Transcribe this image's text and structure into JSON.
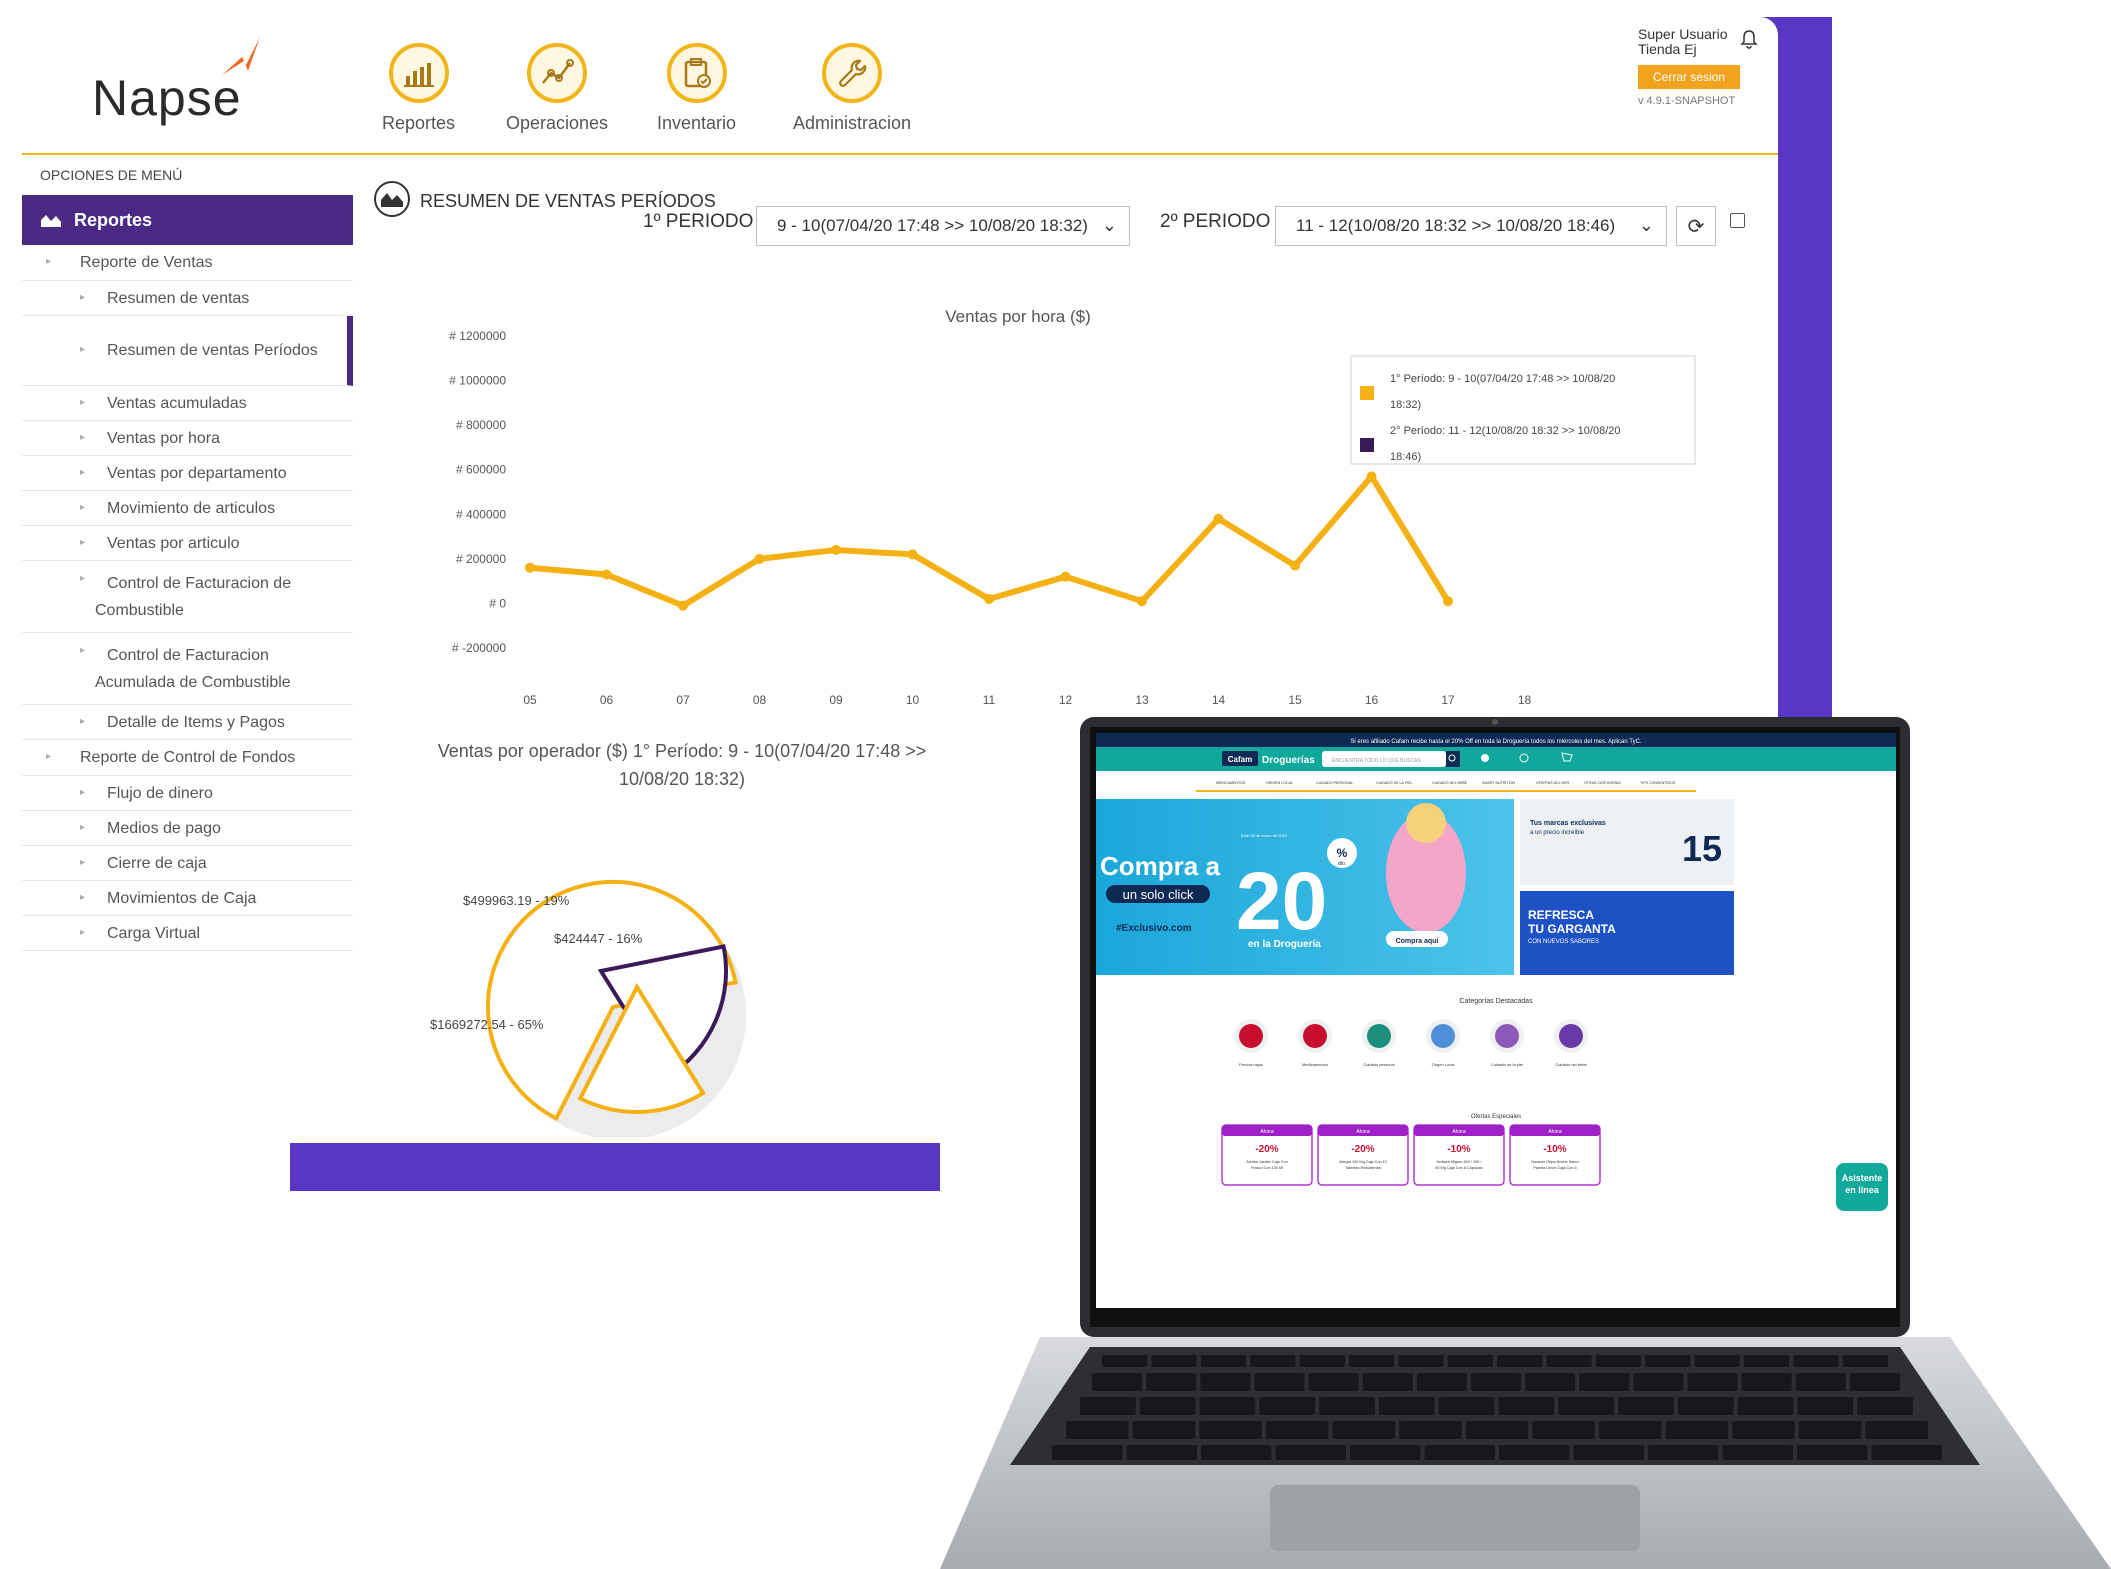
{
  "brand": {
    "name": "Napse"
  },
  "topnav": [
    {
      "label": "Reportes",
      "icon": "chart-bar-icon"
    },
    {
      "label": "Operaciones",
      "icon": "line-graph-icon"
    },
    {
      "label": "Inventario",
      "icon": "clipboard-check-icon"
    },
    {
      "label": "Administracion",
      "icon": "wrench-icon"
    }
  ],
  "user": {
    "name": "Super Usuario",
    "store": "Tienda Ej",
    "logout_label": "Cerrar sesion",
    "version": "v 4.9.1-SNAPSHOT"
  },
  "sidebar": {
    "title": "OPCIONES DE MENÚ",
    "active": "Reportes",
    "items": [
      {
        "label": "Reporte de Ventas",
        "level": 1
      },
      {
        "label": "Resumen de ventas",
        "level": 2
      },
      {
        "label": "Resumen de ventas Períodos",
        "level": 2,
        "selected": true
      },
      {
        "label": "Ventas acumuladas",
        "level": 2
      },
      {
        "label": "Ventas por hora",
        "level": 2
      },
      {
        "label": "Ventas por departamento",
        "level": 2
      },
      {
        "label": "Movimiento de articulos",
        "level": 2
      },
      {
        "label": "Ventas por articulo",
        "level": 2
      },
      {
        "label": "Control de Facturacion de Combustible",
        "level": 2
      },
      {
        "label": "Control de Facturacion Acumulada de Combustible",
        "level": 2
      },
      {
        "label": "Detalle de Items y Pagos",
        "level": 2
      },
      {
        "label": "Reporte de Control de Fondos",
        "level": 1
      },
      {
        "label": "Flujo de dinero",
        "level": 2
      },
      {
        "label": "Medios de pago",
        "level": 2
      },
      {
        "label": "Cierre de caja",
        "level": 2
      },
      {
        "label": "Movimientos de Caja",
        "level": 2
      },
      {
        "label": "Carga Virtual",
        "level": 2
      }
    ]
  },
  "main": {
    "title": "RESUMEN DE VENTAS PERÍODOS",
    "period1_label": "1º PERIODO",
    "period1_value": "9 - 10(07/04/20 17:48 >> 10/08/20 18:32)",
    "period2_label": "2º PERIODO",
    "period2_value": "11 - 12(10/08/20 18:32 >> 10/08/20 18:46)"
  },
  "chart_data": [
    {
      "type": "line",
      "title": "Ventas por hora ($)",
      "x": [
        "05",
        "06",
        "07",
        "08",
        "09",
        "10",
        "11",
        "12",
        "13",
        "14",
        "15",
        "16",
        "17",
        "18"
      ],
      "ytick_labels": [
        "# 1200000",
        "# 1000000",
        "# 800000",
        "# 600000",
        "# 400000",
        "# 200000",
        "# 0",
        "# -200000"
      ],
      "ylim": [
        -200000,
        1200000
      ],
      "series": [
        {
          "name": "1° Período: 9 - 10(07/04/20 17:48 >> 10/08/20 18:32)",
          "color": "#f5b014",
          "values": [
            160000,
            130000,
            -10000,
            200000,
            240000,
            220000,
            20000,
            120000,
            10000,
            380000,
            170000,
            570000,
            10000,
            null
          ]
        },
        {
          "name": "2° Período: 11 - 12(10/08/20 18:32 >> 10/08/20 18:46)",
          "color": "#3b1a5a",
          "values": []
        }
      ],
      "legend_position": "top-right"
    },
    {
      "type": "pie",
      "title": "Ventas por operador ($) 1° Período: 9 - 10(07/04/20 17:48 >> 10/08/20 18:32)",
      "slices": [
        {
          "label": "$1669272.54 - 65%",
          "value": 1669272.54,
          "percent": 65,
          "color": "#ffffff"
        },
        {
          "label": "$499963.19 - 19%",
          "value": 499963.19,
          "percent": 19,
          "color": "#ffffff"
        },
        {
          "label": "$424447 - 16%",
          "value": 424447,
          "percent": 16,
          "color": "#ffffff"
        }
      ]
    }
  ],
  "laptop_site": {
    "banner": "Si eres afiliado Cafam recibe hasta el 20% Off en toda la Droguería todos los miércoles del mes. Aplican TyC.",
    "brand": "Cafam",
    "brand_section": "Droguerías",
    "search_placeholder": "ENCUENTRA TODO LO QUE BUSCAS",
    "menu": [
      "MEDICAMENTOS",
      "ORIGEN LOCAL",
      "CUIDADO PERSONAL",
      "CUIDADO DE LA PIEL",
      "CUIDADO DEL BEBÉ",
      "SMART NUTRITION",
      "OFERTAS DEL MES",
      "OTRAS CATEGORÍAS",
      "TIPS CONSENTIDOS"
    ],
    "hero_line1": "Compra a",
    "hero_line2": "un solo click",
    "hero_hashtag": "#Exclusivo.com",
    "hero_number": "20",
    "hero_percent": "%",
    "hero_pct_sub": "dto.",
    "hero_sub": "en la Droguería",
    "hero_cta": "Compra aquí",
    "hero_date": "Este 16 de enero de 2024",
    "side1_title": "Tus marcas exclusivas",
    "side1_sub": "a un precio increíble",
    "side1_number": "15",
    "side2_line1": "REFRESCA",
    "side2_line2": "TU GARGANTA",
    "side2_line3": "CON NUEVOS SABORES",
    "categories_title": "Categorías Destacadas",
    "categories": [
      "Precios bajos",
      "Medicamentos",
      "Cuidado personal",
      "Origen Local",
      "Cuidado de la piel",
      "Cuidado del bebé"
    ],
    "offers_title": "Ofertas Especiales",
    "offers": [
      {
        "tag": "Ahora",
        "discount": "-20%",
        "name": "Alerliar Jarabe Caja Con Frasco Con 100 Ml"
      },
      {
        "tag": "Ahora",
        "discount": "-20%",
        "name": "Allegra 120 Mg Caja Con 10 Tabletas Recubiertas"
      },
      {
        "tag": "Ahora",
        "discount": "-10%",
        "name": "Ibuflash Migren 400 / 250 / 65 Mg Caja Con 8 Cápsulas"
      },
      {
        "tag": "Ahora",
        "discount": "-10%",
        "name": "Noxaver Gripa Noche Sabor Panela Limón Caja Con 6"
      }
    ],
    "assistant_line1": "Asistente",
    "assistant_line2": "en línea"
  }
}
